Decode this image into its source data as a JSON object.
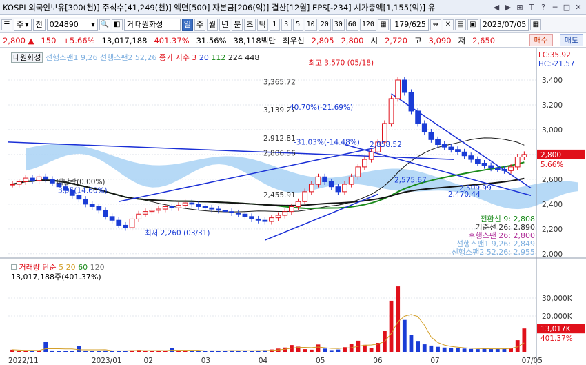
{
  "info_bar": {
    "text": "KOSPI 외국인보유[300(천)] 주식수[41,249(천)] 액면[500] 자본금[206(억)] 결산[12월] EPS[-234] 시가총액[1,155(억)] 유",
    "controls": [
      "◀",
      "▶",
      "⊞",
      "T",
      "?",
      "─",
      "□",
      "✕"
    ]
  },
  "toolbar": {
    "market": "주",
    "prev_label": "전",
    "code": "024890",
    "name_prefix": "거",
    "stock_name": "대원화성",
    "periods": [
      "일",
      "주",
      "월",
      "년",
      "분",
      "초",
      "틱"
    ],
    "selected_period": "일",
    "intervals": [
      "1",
      "3",
      "5",
      "10",
      "20",
      "30",
      "60",
      "120"
    ],
    "page": "179/625",
    "date": "2023/07/05"
  },
  "price_bar": {
    "price": "2,800",
    "arrow": "▲",
    "change": "150",
    "change_pct": "+5.66%",
    "volume": "13,017,188",
    "volume_ratio": "401.37%",
    "turnover": "31.56%",
    "amount": "38,118백만",
    "quote_label": "최우선",
    "ask": "2,805",
    "bid": "2,800",
    "open_label": "시",
    "open": "2,720",
    "high_label": "고",
    "high": "3,090",
    "low_label": "저",
    "low": "2,650",
    "buy_label": "매수",
    "sell_label": "매도"
  },
  "legend": {
    "stock": "대원화성",
    "span1": "선행스팬1 9,26",
    "span2": "선행스팬2 52,26",
    "ma_title": "종가 지수 3",
    "ma_periods": [
      "20",
      "112",
      "224",
      "448"
    ],
    "lc": "LC:35.92",
    "hc": "HC:-21.57"
  },
  "ichimoku_labels": {
    "conversion": "전환선 9: 2,808",
    "base": "기준선 26: 2,890",
    "lagging": "후행스팬 26: 2,800",
    "lead1": "선행스팬1 9,26: 2,849",
    "lead2": "선행스팬2 52,26: 2,955"
  },
  "annotations": {
    "high": "최고 3,570 (05/18)",
    "low": "최저 2,260 (03/31)",
    "dividend": "배당락(0.00%)",
    "dividend_sub": "3.95(14.60%)",
    "fib_3365": "3,365.72",
    "fib_3139": "3,139.27",
    "fib_2912": "2,912.81",
    "fib_2806": "2,806.56",
    "fib_2455": "2,455.91",
    "pct1": "40.70%(-21.69%)",
    "pct2": "-31.03%(-14.48%)",
    "val_2858": "2,858.52",
    "val_2575": "2,575.67",
    "val_2509": "2,509.99",
    "val_2470": "2,470.44"
  },
  "price_axis": [
    "3,400",
    "3,200",
    "3,000",
    "2,800",
    "2,600",
    "2,400",
    "2,200",
    "2,000"
  ],
  "current_price_tag": "2,800",
  "current_pct_tag": "5.66%",
  "volume_panel": {
    "title": "거래량",
    "ma_label": "단순",
    "ma_periods": [
      "5",
      "20",
      "60",
      "120"
    ],
    "value": "13,017,188주(401.37%)",
    "axis": [
      "30,000K",
      "20,000K"
    ],
    "tag": "13,017K",
    "tag_pct": "401.37%"
  },
  "time_axis": [
    "2022/11",
    "2023/01",
    "02",
    "03",
    "04",
    "05",
    "06",
    "07",
    "07/05"
  ],
  "colors": {
    "up": "#e0101a",
    "down": "#1a3cd6",
    "cloud": "#a9d2f5",
    "ma20": "#1a1a1a",
    "ma112": "#1a8a1a",
    "ma224": "#141414",
    "trend": "#1a2fd6"
  },
  "chart_data": {
    "type": "candlestick",
    "x_range": [
      "2022/11",
      "2023/07/05"
    ],
    "ylim": [
      2000,
      3500
    ],
    "y_ticks": [
      2000,
      2200,
      2400,
      2600,
      2800,
      3000,
      3200,
      3400
    ],
    "last_close": 2800,
    "high_point": {
      "date": "05/18",
      "value": 3570
    },
    "low_point": {
      "date": "03/31",
      "value": 2260
    },
    "closes": [
      2560,
      2580,
      2610,
      2590,
      2620,
      2600,
      2570,
      2540,
      2510,
      2470,
      2440,
      2400,
      2380,
      2350,
      2300,
      2270,
      2230,
      2210,
      2280,
      2320,
      2340,
      2350,
      2360,
      2380,
      2370,
      2390,
      2410,
      2400,
      2380,
      2370,
      2360,
      2350,
      2340,
      2330,
      2320,
      2300,
      2280,
      2270,
      2260,
      2290,
      2310,
      2340,
      2380,
      2420,
      2500,
      2560,
      2620,
      2580,
      2540,
      2500,
      2560,
      2620,
      2700,
      2760,
      2820,
      2900,
      3050,
      3250,
      3400,
      3300,
      3150,
      3050,
      2980,
      2920,
      2880,
      2860,
      2840,
      2820,
      2790,
      2760,
      2730,
      2710,
      2690,
      2680,
      2670,
      2700,
      2780,
      2800
    ],
    "volumes": [
      1.2,
      0.8,
      0.6,
      0.9,
      0.7,
      5.6,
      0.8,
      0.6,
      0.5,
      0.7,
      3.4,
      0.6,
      0.5,
      0.6,
      0.8,
      0.7,
      0.5,
      0.6,
      0.9,
      1.1,
      0.6,
      0.5,
      0.7,
      0.6,
      2.2,
      0.6,
      0.5,
      0.7,
      0.6,
      0.5,
      0.8,
      0.6,
      0.7,
      0.9,
      0.6,
      0.5,
      0.7,
      0.8,
      1.0,
      1.3,
      1.8,
      2.4,
      3.8,
      2.9,
      1.5,
      1.2,
      4.1,
      1.8,
      1.0,
      1.3,
      2.6,
      4.5,
      6.2,
      3.9,
      2.1,
      5.0,
      11.8,
      28.5,
      36.5,
      17.8,
      9.5,
      6.1,
      4.2,
      3.5,
      2.8,
      2.4,
      2.2,
      2.0,
      1.8,
      1.6,
      1.5,
      1.9,
      1.7,
      1.6,
      1.8,
      2.3,
      6.5,
      13.0
    ]
  }
}
